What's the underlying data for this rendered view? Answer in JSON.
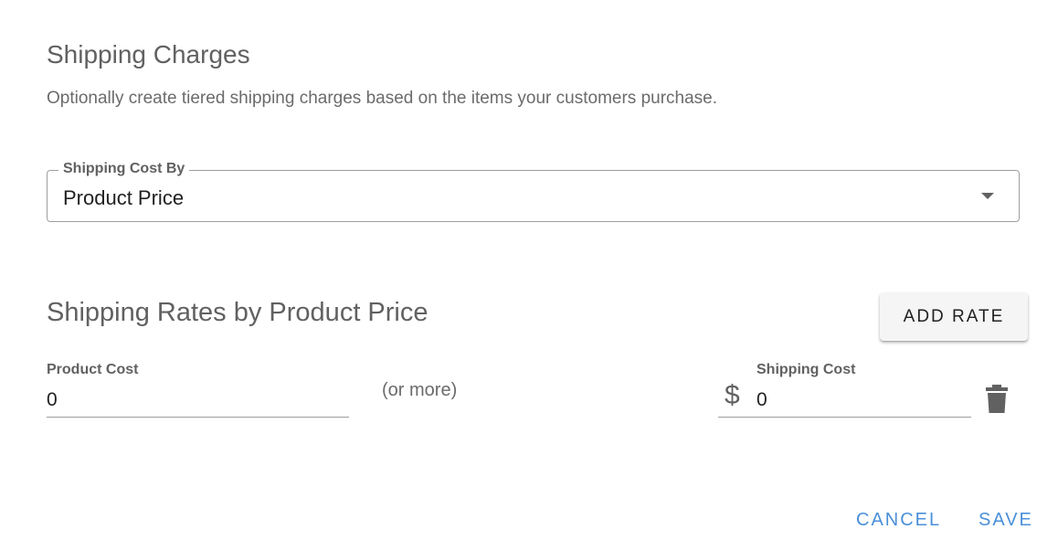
{
  "header": {
    "title": "Shipping Charges",
    "description": "Optionally create tiered shipping charges based on the items your customers purchase."
  },
  "shipping_cost_by": {
    "label": "Shipping Cost By",
    "value": "Product Price",
    "icon": "dropdown-arrow-icon"
  },
  "rates": {
    "title": "Shipping Rates by Product Price",
    "add_label": "ADD RATE",
    "rows": [
      {
        "product_cost_label": "Product Cost",
        "product_cost_value": "0",
        "or_more": "(or more)",
        "shipping_cost_label": "Shipping Cost",
        "currency_symbol": "$",
        "shipping_cost_value": "0",
        "delete_icon": "trash-icon"
      }
    ]
  },
  "actions": {
    "cancel_label": "CANCEL",
    "save_label": "SAVE"
  },
  "colors": {
    "accent": "#4a90d9",
    "text": "#616161",
    "input_text": "#212121"
  }
}
